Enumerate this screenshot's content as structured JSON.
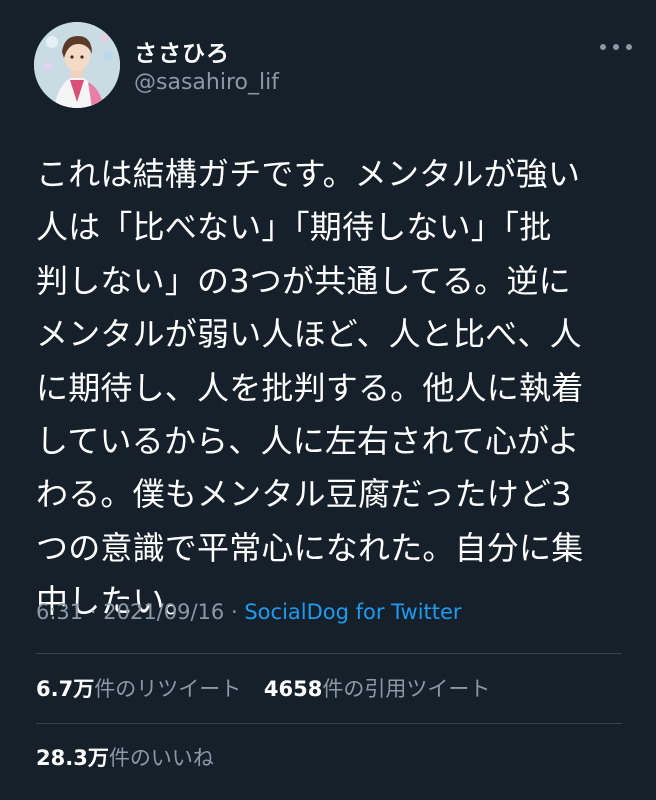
{
  "author": {
    "name": "ささひろ",
    "handle": "@sasahiro_lif"
  },
  "tweet": {
    "text": "これは結構ガチです。メンタルが強い\n人は「比べない」「期待しない」「批\n判しない」の3つが共通してる。逆に\nメンタルが弱い人ほど、人と比べ、人\nに期待し、人を批判する。他人に執着\nしているから、人に左右されて心がよ\nわる。僕もメンタル豆腐だったけど3\nつの意識で平常心になれた。自分に集\n中したい。",
    "time": "6:31",
    "separator": "·",
    "date": "2021/09/16",
    "source": "SocialDog for Twitter"
  },
  "stats": {
    "retweets_value": "6.7万",
    "retweets_label": "件のリツイート",
    "quotes_value": "4658",
    "quotes_label": "件の引用ツイート",
    "likes_value": "28.3万",
    "likes_label": "件のいいね"
  },
  "icons": {
    "more": "more-horizontal-icon"
  },
  "colors": {
    "background": "#15202b",
    "text": "#ffffff",
    "secondary_text": "#8b98a5",
    "link": "#1d9bf0",
    "divider": "#38444d"
  }
}
